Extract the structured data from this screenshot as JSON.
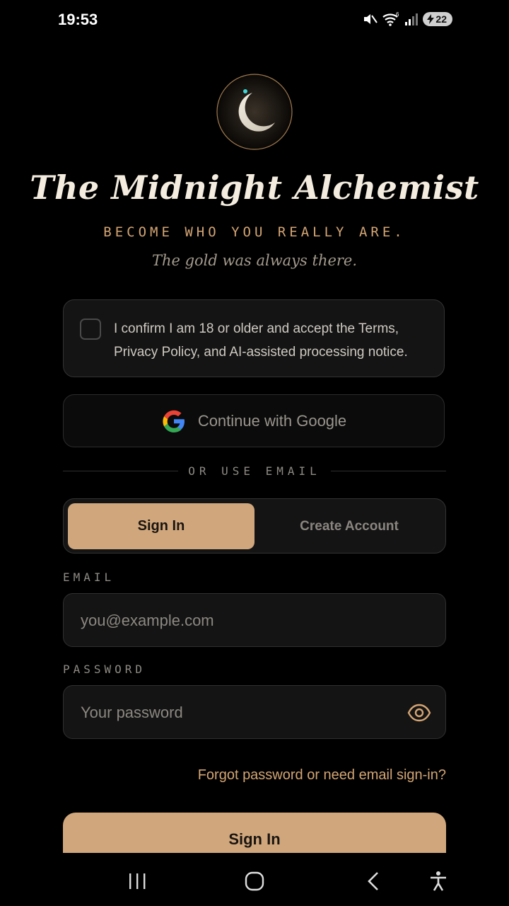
{
  "status_bar": {
    "time": "19:53",
    "network_superscript": "6",
    "battery": "22"
  },
  "brand": {
    "logo_icon": "crescent-moon-icon",
    "title": "The Midnight Alchemist",
    "tagline": "BECOME WHO YOU REALLY ARE.",
    "subtitle": "The gold was always there."
  },
  "consent": {
    "checked": false,
    "text": "I confirm I am 18 or older and accept the Terms, Privacy Policy, and AI-assisted processing notice."
  },
  "google_button": {
    "label": "Continue with Google",
    "icon": "google-logo-icon"
  },
  "divider": {
    "text": "OR USE EMAIL"
  },
  "mode_tabs": {
    "active": "Sign In",
    "inactive": "Create Account"
  },
  "email": {
    "label": "EMAIL",
    "placeholder": "you@example.com",
    "value": ""
  },
  "password": {
    "label": "PASSWORD",
    "placeholder": "Your password",
    "value": "",
    "toggle_icon": "eye-icon"
  },
  "forgot_link": "Forgot password or need email sign-in?",
  "submit_button": "Sign In",
  "nav_bar": {
    "items": [
      "recent-apps-icon",
      "home-icon",
      "back-icon",
      "accessibility-icon"
    ]
  },
  "colors": {
    "background": "#000000",
    "accent": "#d0a77c",
    "accent_text": "#d4a574",
    "surface": "#141414",
    "title": "#f3ecdf"
  }
}
